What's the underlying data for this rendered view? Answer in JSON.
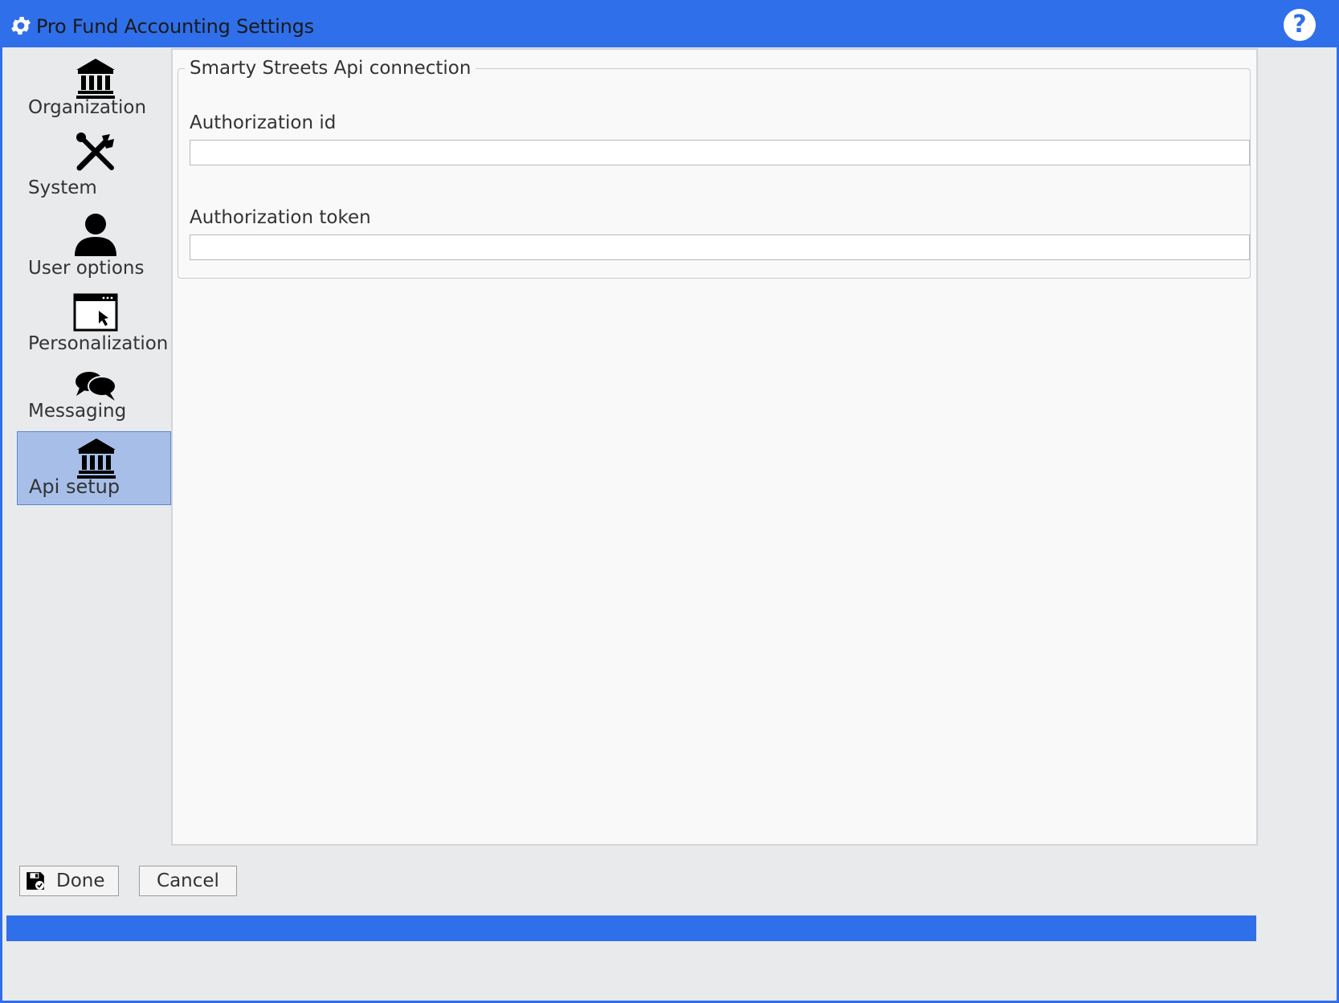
{
  "window": {
    "title": "Pro Fund Accounting Settings",
    "help_label": "?"
  },
  "sidebar": {
    "items": [
      {
        "label": "Organization",
        "icon": "bank-icon"
      },
      {
        "label": "System",
        "icon": "tools-icon"
      },
      {
        "label": "User options",
        "icon": "user-icon"
      },
      {
        "label": "Personalization",
        "icon": "window-cursor-icon"
      },
      {
        "label": "Messaging",
        "icon": "chat-bubbles-icon"
      },
      {
        "label": "Api setup",
        "icon": "bank-icon",
        "selected": true
      }
    ]
  },
  "main": {
    "group_title": "Smarty Streets Api connection",
    "fields": [
      {
        "label": "Authorization id",
        "value": ""
      },
      {
        "label": "Authorization token",
        "value": ""
      }
    ]
  },
  "footer": {
    "done_label": "Done",
    "cancel_label": "Cancel"
  },
  "colors": {
    "accent": "#2f6fe9",
    "selected_bg": "#a7bfe8"
  }
}
